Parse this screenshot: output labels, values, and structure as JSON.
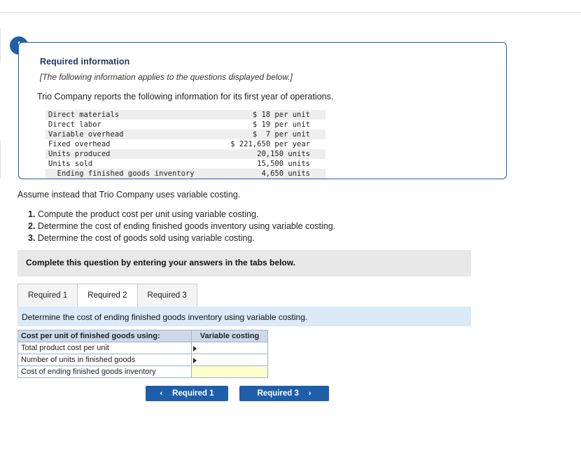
{
  "info_card": {
    "badge": "!",
    "title": "Required information",
    "subtitle": "[The following information applies to the questions displayed below.]",
    "lead": "Trio Company reports the following information for its first year of operations.",
    "rows": [
      {
        "label": "Direct materials",
        "value": "$ 18 per unit"
      },
      {
        "label": "Direct labor",
        "value": "$ 19 per unit"
      },
      {
        "label": "Variable overhead",
        "value": "$  7 per unit"
      },
      {
        "label": "Fixed overhead",
        "value": "$ 221,650 per year"
      },
      {
        "label": "Units produced",
        "value": "20,150 units"
      },
      {
        "label": "Units sold",
        "value": "15,500 units"
      },
      {
        "label": "  Ending finished goods inventory",
        "value": "4,650 units"
      }
    ]
  },
  "assume_text": "Assume instead that Trio Company uses variable costing.",
  "requirements": [
    {
      "num": "1.",
      "text": " Compute the product cost per unit using variable costing."
    },
    {
      "num": "2.",
      "text": " Determine the cost of ending finished goods inventory using variable costing."
    },
    {
      "num": "3.",
      "text": " Determine the cost of goods sold using variable costing."
    }
  ],
  "complete_bar": {
    "text": "Complete this question by entering your answers in the tabs below."
  },
  "tabs": [
    {
      "label": "Required 1",
      "active": false
    },
    {
      "label": "Required 2",
      "active": true
    },
    {
      "label": "Required 3",
      "active": false
    }
  ],
  "instruction": {
    "text": "Determine the cost of ending finished goods inventory using variable costing."
  },
  "answer_table": {
    "header_left": "Cost per unit of finished goods using:",
    "header_right": "Variable costing",
    "rows": [
      {
        "label": "Total product cost per unit",
        "value": "",
        "highlight": false
      },
      {
        "label": "Number of units in finished goods",
        "value": "",
        "highlight": false
      },
      {
        "label": "Cost of ending finished goods inventory",
        "value": "",
        "highlight": true
      }
    ]
  },
  "nav": {
    "prev_label": "Required 1",
    "prev_arrow": "‹",
    "next_label": "Required 3",
    "next_arrow": "›"
  },
  "colors": {
    "accent": "#1f5fa9",
    "card_border": "#1f5fa9",
    "strip_blue": "#dbeaf7",
    "bar_grey": "#e8e8e8",
    "table_header": "#cdd9e8",
    "highlight": "#ffffcc"
  }
}
